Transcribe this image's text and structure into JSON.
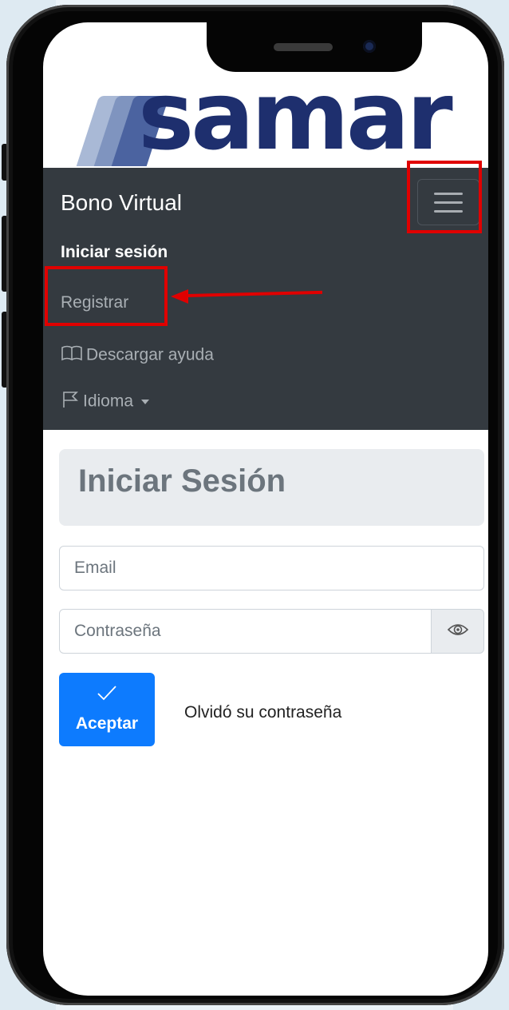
{
  "logo": {
    "text": "samar"
  },
  "navbar": {
    "brand": "Bono Virtual",
    "items": [
      {
        "label": "Iniciar sesión",
        "active": true
      },
      {
        "label": "Registrar"
      },
      {
        "label": "Descargar ayuda",
        "icon": "book-icon"
      },
      {
        "label": "Idioma",
        "icon": "flag-icon",
        "dropdown": true
      }
    ],
    "toggler_icon": "hamburger-icon"
  },
  "login": {
    "title": "Iniciar Sesión",
    "email_placeholder": "Email",
    "password_placeholder": "Contraseña",
    "toggle_password_icon": "eye-icon",
    "accept_label": "Aceptar",
    "accept_icon": "check-icon",
    "forgot_label": "Olvidó su contraseña"
  },
  "annotations": {
    "color": "#e00000"
  },
  "colors": {
    "navbar_bg": "#343a40",
    "primary": "#0d7bfe",
    "logo": "#1e2f6e"
  }
}
